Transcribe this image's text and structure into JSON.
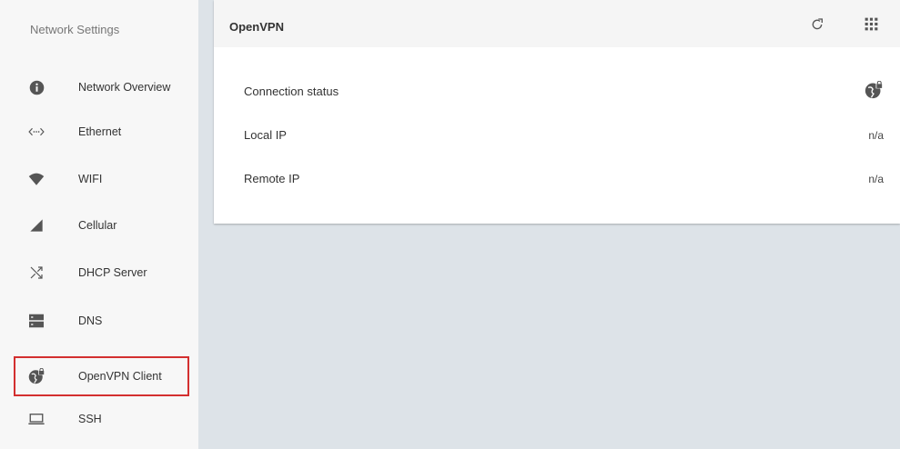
{
  "sidebar": {
    "title": "Network Settings",
    "items": [
      {
        "label": "Network Overview",
        "icon": "info-icon"
      },
      {
        "label": "Ethernet",
        "icon": "ethernet-icon"
      },
      {
        "label": "WIFI",
        "icon": "wifi-icon"
      },
      {
        "label": "Cellular",
        "icon": "cellular-signal-icon"
      },
      {
        "label": "DHCP Server",
        "icon": "shuffle-icon"
      },
      {
        "label": "DNS",
        "icon": "dns-server-icon"
      },
      {
        "label": "OpenVPN Client",
        "icon": "vpn-lock-icon",
        "selected": true
      },
      {
        "label": "SSH",
        "icon": "laptop-icon"
      }
    ]
  },
  "main": {
    "title": "OpenVPN",
    "header_icons": [
      "refresh-icon",
      "apps-grid-icon"
    ],
    "rows": [
      {
        "label": "Connection status",
        "value_icon": "vpn-lock-icon"
      },
      {
        "label": "Local IP",
        "value": "n/a"
      },
      {
        "label": "Remote IP",
        "value": "n/a"
      }
    ]
  },
  "colors": {
    "selection_border": "#d32f2f",
    "sidebar_bg": "#f7f7f7",
    "page_bg": "#dde3e8",
    "icon": "#555555"
  }
}
